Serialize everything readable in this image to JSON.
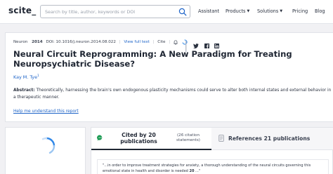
{
  "header": {
    "logo": "scite_",
    "search_placeholder": "Search by title, author, keywords or DOI",
    "nav": {
      "assistant": "Assistant",
      "products": "Products",
      "solutions": "Solutions",
      "pricing": "Pricing",
      "blog": "Blog"
    }
  },
  "article": {
    "journal": "Neuron",
    "year": "2014",
    "doi": "DOI: 10.1016/j.neuron.2014.08.022",
    "full_text_link": "View full text",
    "cite_label": "Cite",
    "title": "Neural Circuit Reprogramming: A New Paradigm for Treating Neuropsychiatric Disease?",
    "author": "Kay M. Tye",
    "author_affiliation": "1",
    "abstract_label": "Abstract:",
    "abstract": "Theoretically, harnessing the brain's own endogenous plasticity mechanisms could serve to alter both internal states and external behavior in a therapeutic manner.",
    "help_link": "Help me understand this report"
  },
  "citations": {
    "cited_by": "Cited by 20 publications",
    "statements": "(26 citation statements)",
    "references": "References 21 publications",
    "snippet": {
      "prefix": "\"...in order to improve treatment strategies for anxiety, a thorough understanding of the neural circuits governing this emotional state in health and disorder is needed",
      "ref": "20",
      "suffix": "...\""
    }
  },
  "colors": {
    "link": "#1e64c8",
    "accent_spinner": "#2f87e8",
    "quote_icon": "#1a9a52",
    "background": "#f1f1f4"
  },
  "icons": [
    "search-icon",
    "bell-icon",
    "loading-spinner",
    "twitter-icon",
    "facebook-icon",
    "linkedin-icon",
    "quote-bubble-icon",
    "references-icon"
  ]
}
